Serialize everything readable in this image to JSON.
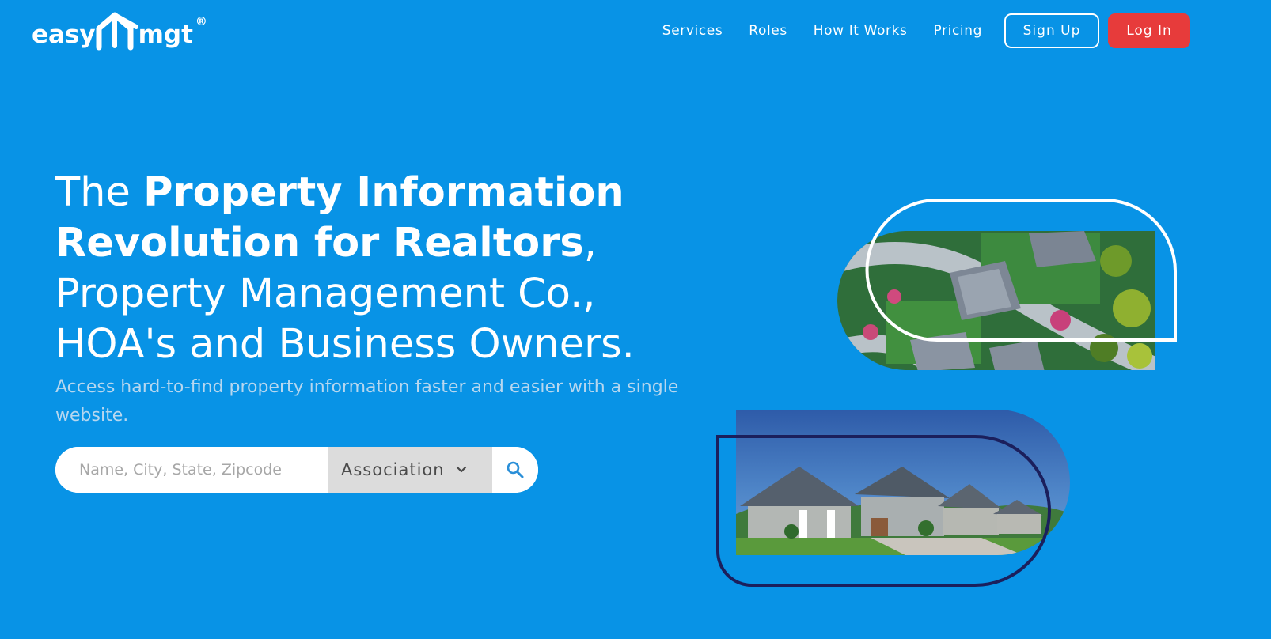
{
  "brand": {
    "name_left": "easy",
    "name_right": "mgt",
    "registered_mark": "®"
  },
  "nav": {
    "links": [
      "Services",
      "Roles",
      "How It Works",
      "Pricing"
    ],
    "signup_label": "Sign Up",
    "login_label": "Log In"
  },
  "hero": {
    "headline_prefix": "The ",
    "headline_bold": "Property Information Revolution for Realtors",
    "headline_line3": ", Property Management Co.,",
    "headline_line4": "HOA's and Business Owners.",
    "subheadline": "Access hard-to-find property information faster and easier with a single website."
  },
  "search": {
    "placeholder": "Name, City, State, Zipcode",
    "value": "",
    "category_selected": "Association"
  },
  "icons": {
    "logo": "house-roof-icon",
    "dropdown": "chevron-down-icon",
    "search": "search-icon"
  },
  "colors": {
    "background": "#0893e6",
    "login_button": "#e73b3b",
    "subheadline": "#b7d7ef",
    "select_background": "#dcdcdc",
    "outline_dark": "#1b1f5c"
  }
}
